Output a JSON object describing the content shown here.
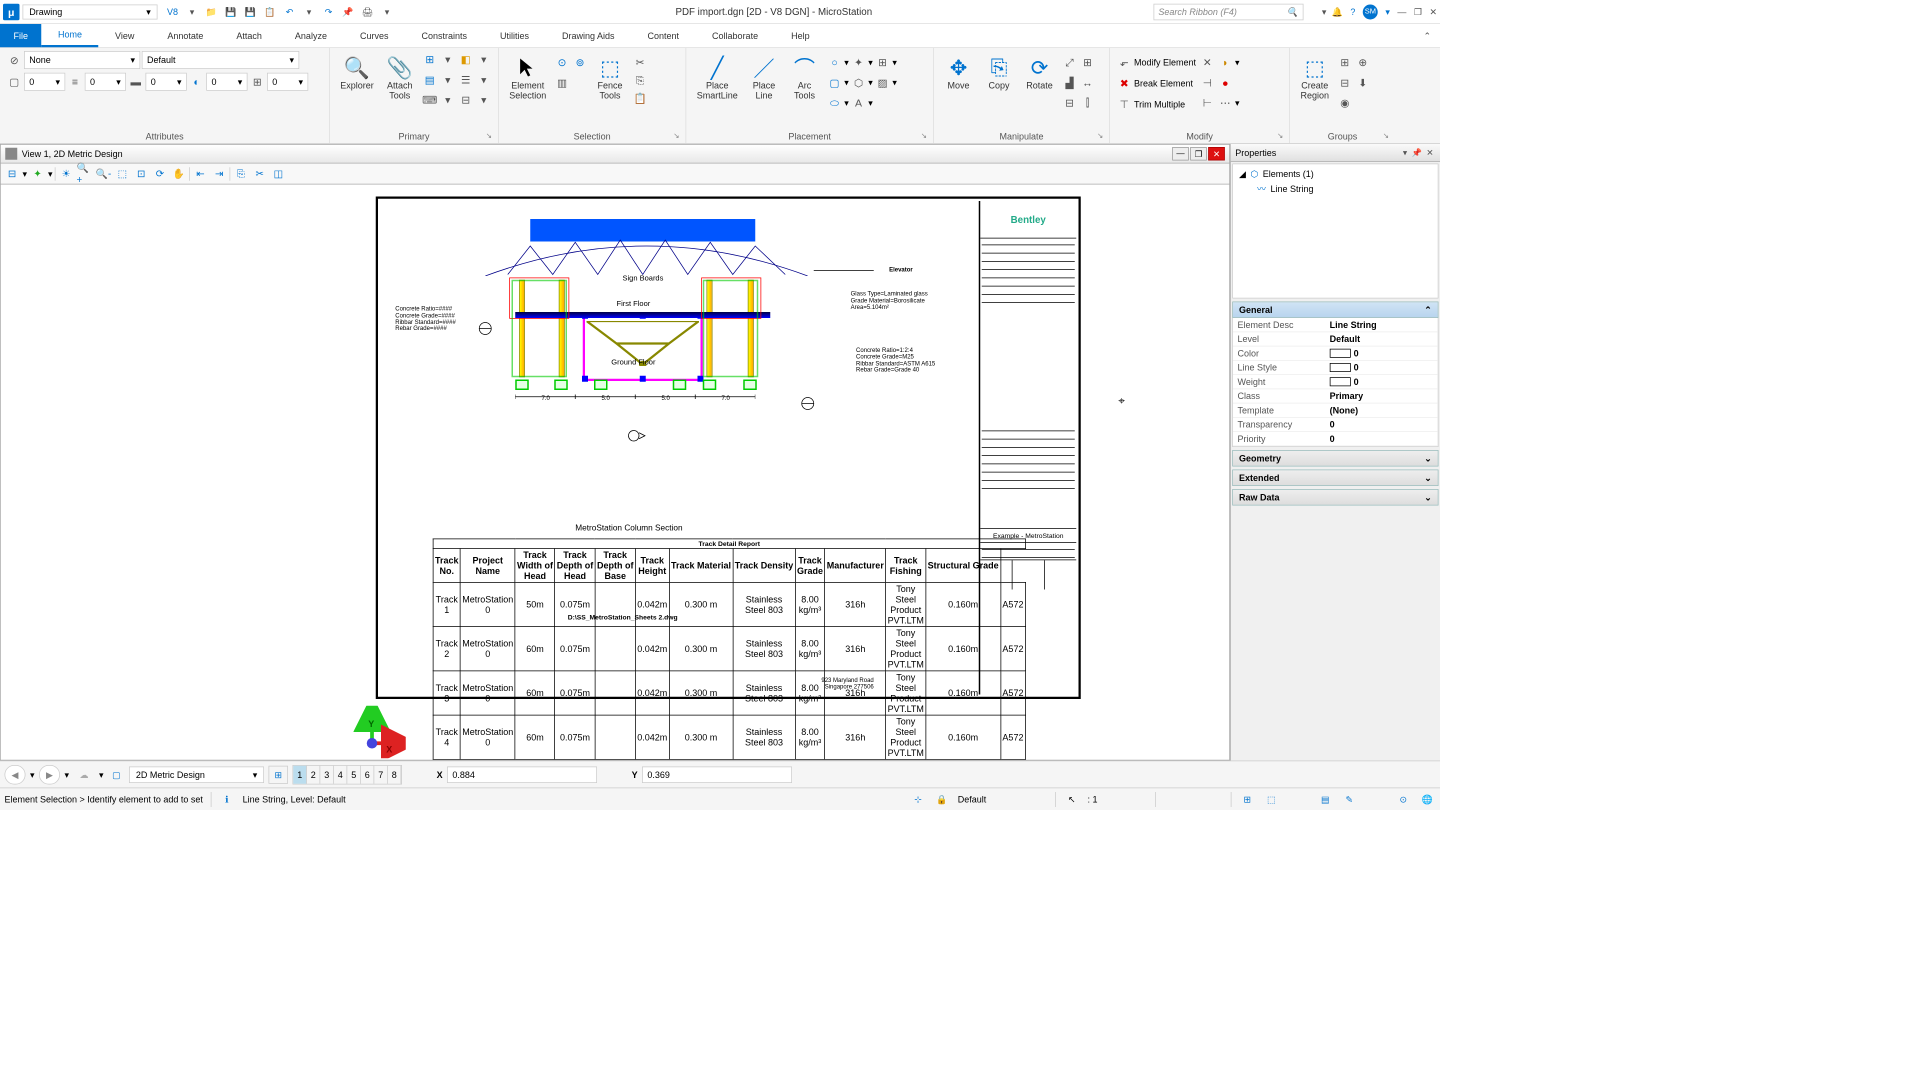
{
  "titlebar": {
    "workflow": "Drawing",
    "title": "PDF import.dgn [2D - V8 DGN] - MicroStation",
    "search_placeholder": "Search Ribbon (F4)"
  },
  "ribbon_tabs": {
    "file": "File",
    "tabs": [
      "Home",
      "View",
      "Annotate",
      "Attach",
      "Analyze",
      "Curves",
      "Constraints",
      "Utilities",
      "Drawing Aids",
      "Content",
      "Collaborate",
      "Help"
    ],
    "active": "Home"
  },
  "ribbon": {
    "attributes": {
      "label": "Attributes",
      "level": "None",
      "template": "Default",
      "line_style": "0",
      "weight": "0",
      "transparency": "0",
      "color": "0",
      "priority": "0"
    },
    "primary": {
      "label": "Primary",
      "explorer": "Explorer",
      "attach_tools": "Attach\nTools"
    },
    "selection": {
      "label": "Selection",
      "element_selection": "Element\nSelection",
      "fence_tools": "Fence\nTools"
    },
    "placement": {
      "label": "Placement",
      "place_smartline": "Place\nSmartLine",
      "place_line": "Place\nLine",
      "arc_tools": "Arc\nTools"
    },
    "manipulate": {
      "label": "Manipulate",
      "move": "Move",
      "copy": "Copy",
      "rotate": "Rotate"
    },
    "modify": {
      "label": "Modify",
      "modify_element": "Modify Element",
      "break_element": "Break Element",
      "trim_multiple": "Trim Multiple"
    },
    "groups": {
      "label": "Groups",
      "create_region": "Create\nRegion"
    }
  },
  "view_window": {
    "title": "View 1, 2D Metric Design"
  },
  "drawing": {
    "annotations": {
      "elevator": "Elevator",
      "sign_boards": "Sign Boards",
      "first_floor": "First Floor",
      "ground_floor": "Ground Floor",
      "glass": "Glass Type=Laminated glass\nGrade Material=Borosilicate\nArea=5.104m²",
      "concrete_left": "Concrete Ratio=####\nConcrete Grade=####\nRibbar Standard=####\nRebar Grade=####",
      "concrete_right": "Concrete Ratio=1:2:4\nConcrete Grade=M25\nRibbar Standard=ASTM A615\nRebar Grade=Grade 40"
    },
    "dims": [
      "7.0",
      "5.0",
      "5.0",
      "7.0"
    ],
    "section_title": "MetroStation Column Section",
    "report_title": "Track Detail Report",
    "report_headers": [
      "Track\nNo.",
      "Project\nName",
      "Track\nWidth of\nHead",
      "Track\nDepth of\nHead",
      "Track\nDepth of\nBase",
      "Track\nHeight",
      "Track Material",
      "Track Density",
      "Track\nGrade",
      "Manufacturer",
      "Track\nFishing",
      "Structural Grade"
    ],
    "report_rows": [
      [
        "Track 1",
        "MetroStation 0",
        "50m",
        "0.075m",
        "",
        "0.042m",
        "0.300 m",
        "Stainless Steel 803",
        "8.00 kg/m³",
        "316h",
        "Tony Steel Product PVT.LTM",
        "0.160m",
        "A572"
      ],
      [
        "Track 2",
        "MetroStation 0",
        "60m",
        "0.075m",
        "",
        "0.042m",
        "0.300 m",
        "Stainless Steel 803",
        "8.00 kg/m³",
        "316h",
        "Tony Steel Product PVT.LTM",
        "0.160m",
        "A572"
      ],
      [
        "Track 3",
        "MetroStation 0",
        "60m",
        "0.075m",
        "",
        "0.042m",
        "0.300 m",
        "Stainless Steel 803",
        "8.00 kg/m³",
        "316h",
        "Tony Steel Product PVT.LTM",
        "0.160m",
        "A572"
      ],
      [
        "Track 4",
        "MetroStation 0",
        "60m",
        "0.075m",
        "",
        "0.042m",
        "0.300 m",
        "Stainless Steel 803",
        "8.00 kg/m³",
        "316h",
        "Tony Steel Product PVT.LTM",
        "0.160m",
        "A572"
      ]
    ],
    "file_path": "D:\\SS_MetroStation_Sheets 2.dwg",
    "address": "923 Maryland Road\nSingapore 277506",
    "titleblock": {
      "logo": "Bentley",
      "project": "Example - MetroStation"
    }
  },
  "properties": {
    "title": "Properties",
    "tree_root": "Elements (1)",
    "tree_item": "Line String",
    "general": {
      "label": "General",
      "rows": [
        {
          "k": "Element Desc",
          "v": "Line String"
        },
        {
          "k": "Level",
          "v": "Default"
        },
        {
          "k": "Color",
          "v": "0",
          "swatch": true
        },
        {
          "k": "Line Style",
          "v": "0",
          "swatch": true
        },
        {
          "k": "Weight",
          "v": "0",
          "swatch": true
        },
        {
          "k": "Class",
          "v": "Primary"
        },
        {
          "k": "Template",
          "v": "(None)"
        },
        {
          "k": "Transparency",
          "v": "0"
        },
        {
          "k": "Priority",
          "v": "0"
        }
      ]
    },
    "collapsed_sections": [
      "Geometry",
      "Extended",
      "Raw Data"
    ]
  },
  "nav": {
    "model": "2D Metric Design",
    "active_view": 1,
    "x_label": "X",
    "x_val": "0.884",
    "y_label": "Y",
    "y_val": "0.369"
  },
  "status": {
    "prompt": "Element Selection > Identify element to add to set",
    "info": "Line String, Level: Default",
    "right_level": "Default",
    "scale": ": 1"
  }
}
